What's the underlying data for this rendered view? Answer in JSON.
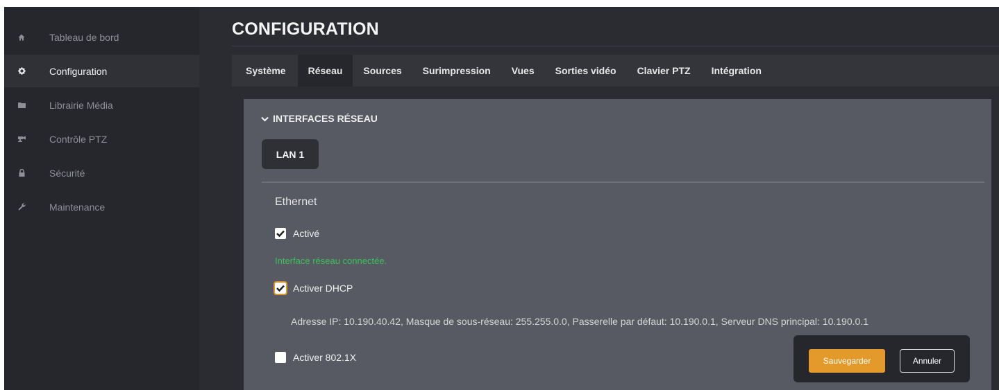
{
  "sidebar": {
    "items": [
      {
        "label": "Tableau de bord",
        "icon": "home-icon"
      },
      {
        "label": "Configuration",
        "icon": "gear-icon",
        "active": true
      },
      {
        "label": "Librairie Média",
        "icon": "folder-icon"
      },
      {
        "label": "Contrôle PTZ",
        "icon": "ptz-camera-icon"
      },
      {
        "label": "Sécurité",
        "icon": "lock-icon"
      },
      {
        "label": "Maintenance",
        "icon": "wrench-icon"
      }
    ]
  },
  "header": {
    "title": "CONFIGURATION"
  },
  "tabs": [
    {
      "label": "Système"
    },
    {
      "label": "Réseau",
      "active": true
    },
    {
      "label": "Sources"
    },
    {
      "label": "Surimpression"
    },
    {
      "label": "Vues"
    },
    {
      "label": "Sorties vidéo"
    },
    {
      "label": "Clavier PTZ"
    },
    {
      "label": "Intégration"
    }
  ],
  "network": {
    "section_title": "INTERFACES RÉSEAU",
    "lan_tab": "LAN 1",
    "ethernet_label": "Ethernet",
    "enabled_label": "Activé",
    "enabled_checked": true,
    "status_text": "Interface réseau connectée.",
    "dhcp_label": "Activer DHCP",
    "dhcp_checked": true,
    "ip_info": "Adresse IP: 10.190.40.42, Masque de sous-réseau: 255.255.0.0, Passerelle par défaut: 10.190.0.1, Serveur DNS principal: 10.190.0.1",
    "dot1x_label": "Activer 802.1X",
    "dot1x_checked": false
  },
  "actions": {
    "save_label": "Sauvegarder",
    "cancel_label": "Annuler"
  },
  "colors": {
    "accent": "#e49a2a",
    "status_ok": "#39c25a",
    "sidebar_bg": "#25272c",
    "panel_bg": "#575a63"
  }
}
